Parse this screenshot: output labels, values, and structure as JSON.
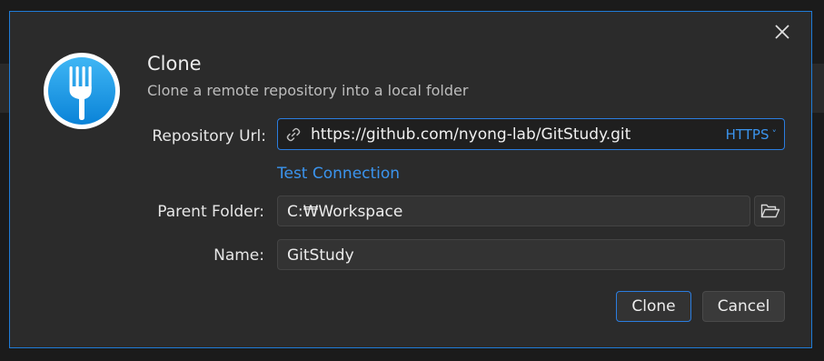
{
  "dialog": {
    "title": "Clone",
    "subtitle": "Clone a remote repository into a local folder"
  },
  "form": {
    "repo_label": "Repository Url:",
    "repo_value": "https://github.com/nyong-lab/GitStudy.git",
    "protocol": "HTTPS",
    "test_connection": "Test Connection",
    "parent_label": "Parent Folder:",
    "parent_value": "C:₩Workspace",
    "name_label": "Name:",
    "name_value": "GitStudy"
  },
  "actions": {
    "clone_label": "Clone",
    "cancel_label": "Cancel"
  },
  "icons": {
    "logo": "fork-app-logo-icon",
    "link": "link-icon",
    "folder": "folder-open-icon",
    "close": "close-icon"
  },
  "colors": {
    "accent": "#1f7bd6",
    "link": "#3b94ee",
    "dialog_bg": "#2b2b2b"
  }
}
